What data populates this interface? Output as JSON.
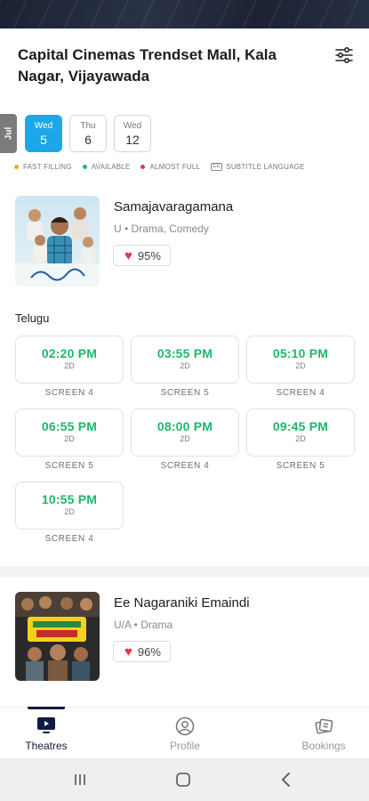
{
  "header": {
    "title": "Capital Cinemas Trendset Mall, Kala Nagar, Vijayawada",
    "filter_icon": "sliders-icon"
  },
  "dates": {
    "month": "Jul",
    "items": [
      {
        "dow": "Wed",
        "day": "5",
        "selected": true
      },
      {
        "dow": "Thu",
        "day": "6",
        "selected": false
      },
      {
        "dow": "Wed",
        "day": "12",
        "selected": false
      }
    ]
  },
  "legend": {
    "fast_filling": "FAST FILLING",
    "available": "AVAILABLE",
    "almost_full": "ALMOST FULL",
    "subtitle_language": "SUBTITLE LANGUAGE",
    "subtitle_icon_text": "CC",
    "colors": {
      "fast_filling": "#f5a623",
      "available": "#1fb76a",
      "almost_full": "#e53845"
    }
  },
  "movies": [
    {
      "title": "Samajavaragamana",
      "meta": "U • Drama, Comedy",
      "rating": "95%",
      "language": "Telugu",
      "showtimes": [
        {
          "time": "02:20 PM",
          "format": "2D",
          "screen": "SCREEN 4"
        },
        {
          "time": "03:55 PM",
          "format": "2D",
          "screen": "SCREEN 5"
        },
        {
          "time": "05:10 PM",
          "format": "2D",
          "screen": "SCREEN 4"
        },
        {
          "time": "06:55 PM",
          "format": "2D",
          "screen": "SCREEN 5"
        },
        {
          "time": "08:00 PM",
          "format": "2D",
          "screen": "SCREEN 4"
        },
        {
          "time": "09:45 PM",
          "format": "2D",
          "screen": "SCREEN 5"
        },
        {
          "time": "10:55 PM",
          "format": "2D",
          "screen": "SCREEN 4"
        }
      ]
    },
    {
      "title": "Ee Nagaraniki Emaindi",
      "meta": "U/A • Drama",
      "rating": "96%"
    }
  ],
  "bottom_nav": {
    "items": [
      {
        "label": "Theatres",
        "icon": "play-screen-icon",
        "active": true
      },
      {
        "label": "Profile",
        "icon": "user-circle-icon",
        "active": false
      },
      {
        "label": "Bookings",
        "icon": "tickets-icon",
        "active": false
      }
    ]
  },
  "accent_colors": {
    "primary": "#1ea7e8",
    "available_time": "#1fb76a",
    "heart": "#e53845",
    "nav_active": "#101a44"
  }
}
